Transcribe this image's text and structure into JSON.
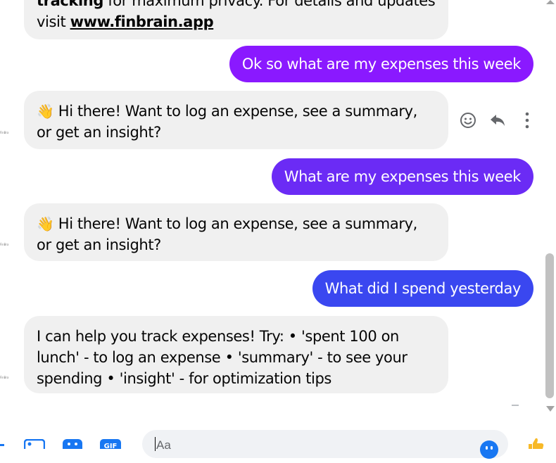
{
  "colors": {
    "incoming_bg": "#f0f0f0",
    "outgoing_1": "#8a19ff",
    "outgoing_2": "#6b2bf5",
    "outgoing_3": "#3a47f0",
    "icon_blue": "#1877f2",
    "icon_gray": "#65676b"
  },
  "avatar_label": "FinBrain",
  "messages": {
    "m0": {
      "bold_word": "tracking",
      "text_tail": "for maximum privacy. For details and updates visit",
      "link": "www.finbrain.app"
    },
    "m1": {
      "text": "Ok so what are my expenses this week"
    },
    "m2": {
      "emoji": "👋",
      "text": "Hi there! Want to log an expense, see a summary, or get an insight?"
    },
    "m3": {
      "text": "What are my expenses this week"
    },
    "m4": {
      "emoji": "👋",
      "text": "Hi there! Want to log an expense, see a summary, or get an insight?"
    },
    "m5": {
      "text": "What did I spend yesterday"
    },
    "m6": {
      "text": "I can help you track expenses! Try: • 'spent 100 on lunch' - to log an expense • 'summary' - to see your spending • 'insight' - for optimization tips"
    }
  },
  "message_actions": [
    "react-icon",
    "reply-icon",
    "more-icon"
  ],
  "composer": {
    "placeholder": "Aa",
    "icons": [
      "plus-icon",
      "image-icon",
      "sticker-icon",
      "gif-icon",
      "emoji-icon",
      "thumbs-up-icon"
    ],
    "gif_label": "GIF"
  }
}
